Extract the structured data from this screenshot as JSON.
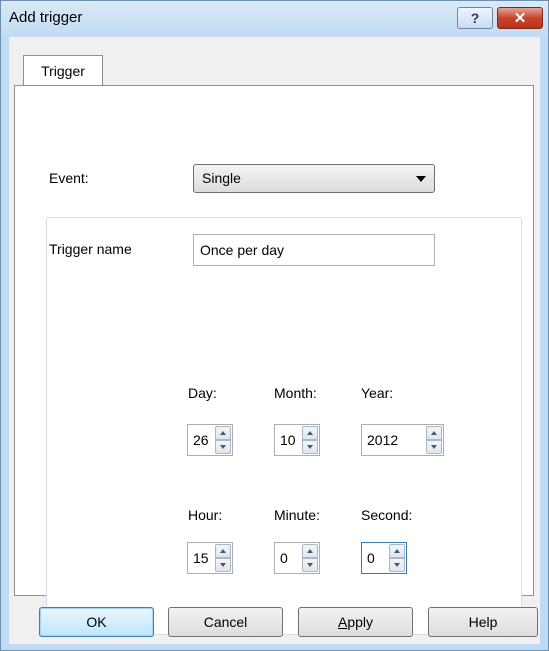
{
  "window": {
    "title": "Add trigger",
    "help_label": "?",
    "close_label": "✕"
  },
  "tabs": [
    {
      "label": "Trigger",
      "active": true
    }
  ],
  "event": {
    "label": "Event:",
    "value": "Single"
  },
  "trigger_name": {
    "label": "Trigger name",
    "value": "Once per day"
  },
  "date": {
    "day": {
      "label": "Day:",
      "value": "26"
    },
    "month": {
      "label": "Month:",
      "value": "10"
    },
    "year": {
      "label": "Year:",
      "value": "2012"
    }
  },
  "time": {
    "hour": {
      "label": "Hour:",
      "value": "15"
    },
    "minute": {
      "label": "Minute:",
      "value": "0"
    },
    "second": {
      "label": "Second:",
      "value": "0"
    }
  },
  "buttons": {
    "ok": "OK",
    "cancel": "Cancel",
    "apply": {
      "mnemonic": "A",
      "rest": "pply"
    },
    "help": "Help"
  },
  "colors": {
    "titlebar": "#c2dbf2",
    "close": "#c7452c",
    "default_button": "#bee6fd"
  },
  "icons": {
    "dropdown": "chevron-down-icon",
    "spin_up": "arrow-up-icon",
    "spin_down": "arrow-down-icon"
  }
}
